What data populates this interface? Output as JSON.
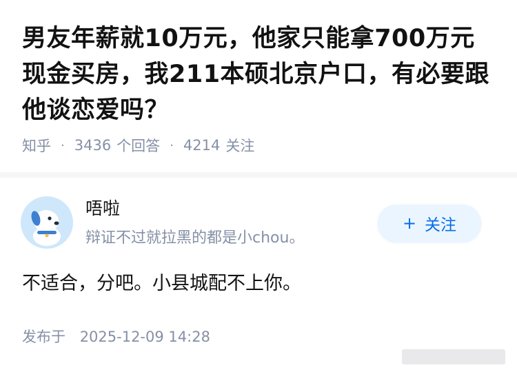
{
  "question": {
    "title": "男友年薪就10万元，他家只能拿700万元现金买房，我211本硕北京户口，有必要跟他谈恋爱吗？"
  },
  "meta": {
    "source": "知乎",
    "separator": "·",
    "answers_count": "3436",
    "answers_label": "个回答",
    "followers_count": "4214",
    "followers_label": "关注"
  },
  "author": {
    "name": "唔啦",
    "bio": "辩证不过就拉黑的都是小chou。",
    "avatar_icon": "dog-avatar-icon",
    "follow_label": "关注",
    "follow_icon": "+"
  },
  "answer": {
    "text": "不适合，分吧。小县城配不上你。"
  },
  "publish": {
    "label": "发布于",
    "datetime": "2025-12-09 14:28"
  },
  "colors": {
    "primary_text": "#121212",
    "secondary_text": "#8590a6",
    "accent_blue": "#056de8",
    "follow_bg": "#ebf5ff",
    "divider": "#f6f6f6"
  }
}
